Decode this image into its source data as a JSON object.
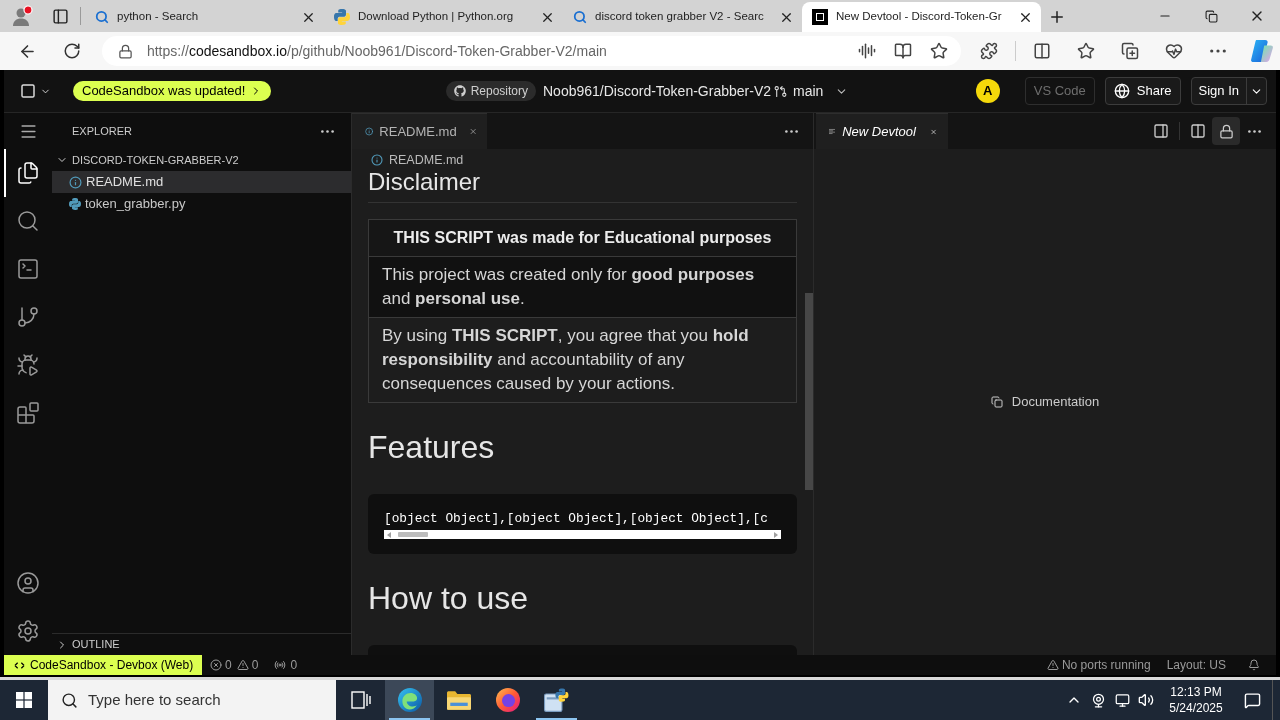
{
  "browser": {
    "tabs": [
      {
        "kind": "search",
        "title": "python - Search",
        "selected": false
      },
      {
        "kind": "python",
        "title": "Download Python | Python.org",
        "selected": false
      },
      {
        "kind": "search",
        "title": "discord token grabber V2 - Searc",
        "selected": false
      },
      {
        "kind": "sandbox",
        "title": "New Devtool - Discord-Token-Gr",
        "selected": true
      }
    ],
    "url": {
      "scheme": "https://",
      "domain": "codesandbox.io",
      "path": "/p/github/Noob961/Discord-Token-Grabber-V2/main"
    }
  },
  "header": {
    "update_badge": "CodeSandbox was updated!",
    "repository_label": "Repository",
    "repository": "Noob961/Discord-Token-Grabber-V2",
    "branch": "main",
    "avatar": "A",
    "buttons": [
      {
        "kind": "plain",
        "label": "VS Code",
        "disabled": true
      },
      {
        "kind": "globe",
        "label": "Share",
        "disabled": false
      },
      {
        "kind": "split",
        "label": "Sign In",
        "disabled": false
      }
    ]
  },
  "activity_bar": {
    "items": [
      {
        "kind": "files",
        "selected": true
      },
      {
        "kind": "search",
        "selected": false
      },
      {
        "kind": "terminal",
        "selected": false
      },
      {
        "kind": "source_control",
        "selected": false
      },
      {
        "kind": "run_debug",
        "selected": false
      },
      {
        "kind": "extensions",
        "selected": false
      }
    ]
  },
  "explorer": {
    "title": "EXPLORER",
    "tree": [
      {
        "label": "DISCORD-TOKEN-GRABBER-V2",
        "expanded": true,
        "children": [
          {
            "kind": "markdown",
            "label": "README.md",
            "selected": true
          },
          {
            "kind": "python",
            "label": "token_grabber.py",
            "selected": false
          }
        ]
      }
    ],
    "outline": {
      "label": "OUTLINE",
      "expanded": false
    }
  },
  "editor": {
    "tabs": [
      {
        "label": "README.md",
        "selected": true
      }
    ],
    "breadcrumb": "README.md",
    "preview": [
      {
        "kind": "h2",
        "text": "Disclaimer"
      },
      {
        "kind": "table",
        "header": "THIS SCRIPT was made for Educational purposes",
        "rows": [
          "This project was created only for **good purposes** and **personal use**.",
          "By using **THIS SCRIPT**, you agree that you **hold responsibility** and accountability of any consequences caused by your actions."
        ]
      },
      {
        "kind": "h1",
        "text": "Features"
      },
      {
        "kind": "code",
        "text": "[object Object],[object Object],[object Object],[c"
      },
      {
        "kind": "h1",
        "text": "How to use"
      },
      {
        "kind": "code"
      }
    ]
  },
  "devtool": {
    "tabs": [
      {
        "label": "New Devtool",
        "selected": true
      }
    ],
    "link": "Documentation"
  },
  "status_bar": {
    "remote": "CodeSandbox - Devbox (Web)",
    "errors": "0",
    "warnings": "0",
    "ports": "0",
    "port_status": "No ports running",
    "layout": "Layout: US"
  },
  "taskbar": {
    "search_placeholder": "Type here to search",
    "apps": [
      {
        "kind": "edge",
        "selected": true,
        "running": true
      },
      {
        "kind": "folder",
        "selected": false,
        "running": false
      },
      {
        "kind": "firefox",
        "selected": false,
        "running": false
      },
      {
        "kind": "installer",
        "selected": false,
        "running": true
      }
    ],
    "time": "12:13 PM",
    "date": "5/24/2025"
  }
}
